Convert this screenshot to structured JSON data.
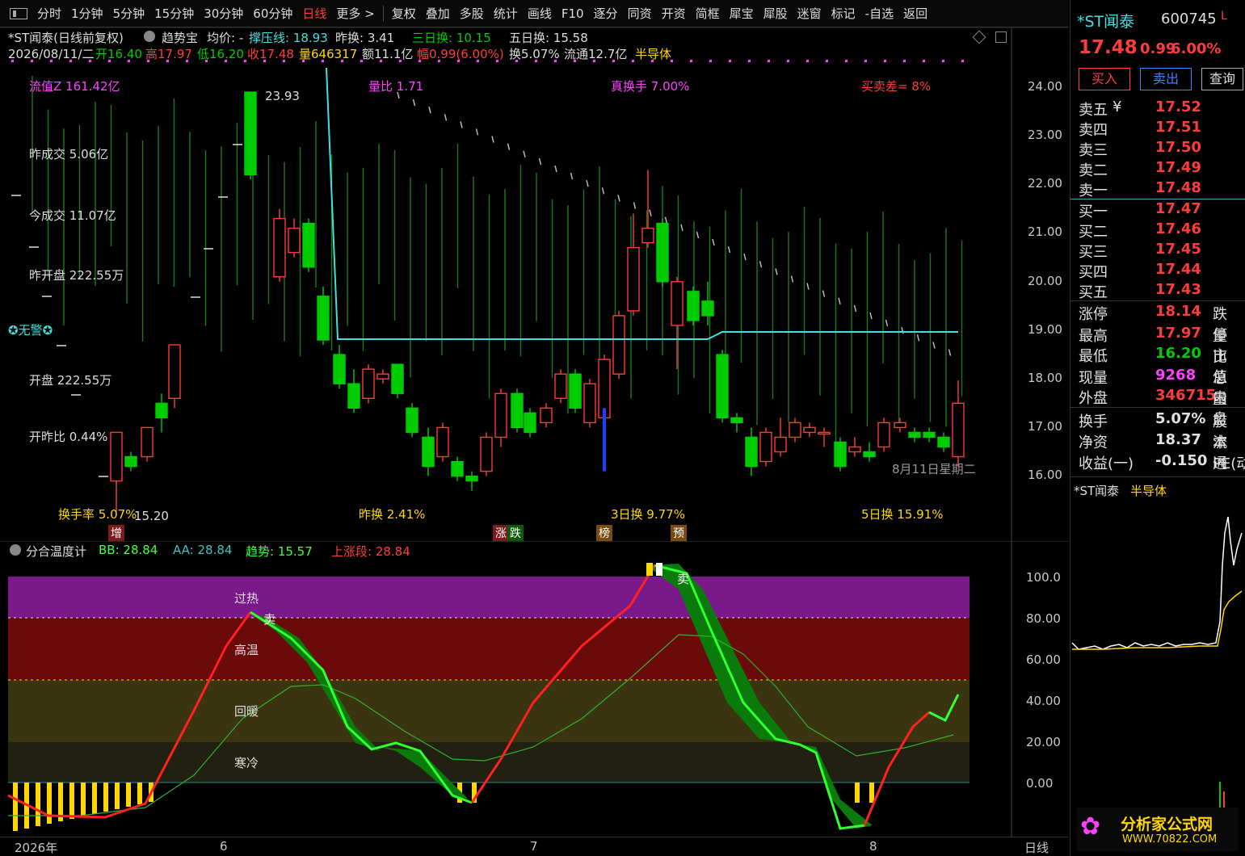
{
  "toolbar": {
    "items": [
      "分时",
      "1分钟",
      "5分钟",
      "15分钟",
      "30分钟",
      "60分钟",
      "日线",
      "更多 >",
      "复权",
      "叠加",
      "多股",
      "统计",
      "画线",
      "F10",
      "逐分",
      "同资",
      "开资",
      "简框",
      "犀宝",
      "犀股",
      "迷窗",
      "标记",
      "-自选",
      "返回"
    ],
    "active": "日线"
  },
  "header": {
    "stock": "*ST闻泰(日线前复权)",
    "formula": "趋势宝",
    "avg": "均价: -",
    "pressure": "撑压线: 18.93",
    "prev_turn": "昨换: 3.41",
    "three_turn": "三日换: 10.15",
    "five_turn": "五日换: 15.58",
    "date": "2026/08/11/二",
    "open": "开16.40",
    "high": "高17.97",
    "low": "低16.20",
    "close": "收17.48",
    "volume": "量646317",
    "amount": "额11.1亿",
    "amp": "幅0.99(6.00%)",
    "turnover": "换5.07%",
    "float": "流通12.7亿",
    "sector": "半导体"
  },
  "overlay": {
    "float_cap": "流值Z 161.42亿",
    "vol_ratio": "量比 1.71",
    "true_turn": "真换手 7.00%",
    "bid_ask": "买卖差= 8%",
    "prev_deal": "昨成交 5.06亿",
    "today_deal": "今成交 11.07亿",
    "prev_open_amt": "昨开盘 222.55万",
    "alarm": "无警",
    "open_amt": "开盘 222.55万",
    "open_ratio": "开昨比 0.44%",
    "turn_rate": "换手率 5.07%",
    "prev_turn2": "昨换 2.41%",
    "turn3": "3日换 9.77%",
    "turn5": "5日换 15.91%",
    "high_mark": "23.93",
    "low_mark": "15.20",
    "date_mark": "8月11日星期二",
    "badges": [
      "增",
      "涨",
      "跌",
      "榜",
      "预"
    ]
  },
  "indicator": {
    "name": "分合温度计",
    "bb": "BB: 28.84",
    "aa": "AA: 28.84",
    "trend": "趋势: 15.57",
    "up": "上涨段: 28.84",
    "zones": [
      "过热",
      "高温",
      "回暖",
      "寒冷"
    ],
    "sell": "卖"
  },
  "price_axis": [
    "24.00",
    "23.00",
    "22.00",
    "21.00",
    "20.00",
    "19.00",
    "18.00",
    "17.00",
    "16.00"
  ],
  "ind_axis": [
    "100.0",
    "80.00",
    "60.00",
    "40.00",
    "20.00",
    "0.00"
  ],
  "xaxis": {
    "labels": [
      "2026年",
      "6",
      "7",
      "8"
    ],
    "period": "日线"
  },
  "quote": {
    "name": "*ST闻泰",
    "code": "600745",
    "flag": "L",
    "price": "17.48",
    "change": "0.99",
    "pct": "6.00%",
    "buy": "买入",
    "sell": "卖出",
    "query": "查询",
    "asks": [
      {
        "l": "卖五",
        "v": "17.52"
      },
      {
        "l": "卖四",
        "v": "17.51"
      },
      {
        "l": "卖三",
        "v": "17.50"
      },
      {
        "l": "卖二",
        "v": "17.49"
      },
      {
        "l": "卖一",
        "v": "17.48"
      }
    ],
    "bids": [
      {
        "l": "买一",
        "v": "17.47"
      },
      {
        "l": "买二",
        "v": "17.46"
      },
      {
        "l": "买三",
        "v": "17.45"
      },
      {
        "l": "买四",
        "v": "17.44"
      },
      {
        "l": "买五",
        "v": "17.43"
      }
    ],
    "stats": [
      {
        "l": "涨停",
        "v": "18.14",
        "t": "跌停"
      },
      {
        "l": "最高",
        "v": "17.97",
        "t": "量比"
      },
      {
        "l": "最低",
        "v": "16.20",
        "t": "市值"
      },
      {
        "l": "现量",
        "v": "9268",
        "t": "总量"
      },
      {
        "l": "外盘",
        "v": "346715",
        "t": "内盘"
      }
    ],
    "extra": [
      {
        "l": "换手",
        "v": "5.07%",
        "t": "股本"
      },
      {
        "l": "净资",
        "v": "18.37",
        "t": "流通"
      },
      {
        "l": "收益(一)",
        "v": "-0.150",
        "t": "PE(动"
      }
    ],
    "mini_title": "*ST闻泰",
    "mini_sector": "半导体"
  },
  "colors": {
    "up": "#ff3b3b",
    "down": "#00cc00",
    "cyan": "#40e0e0",
    "magenta": "#ff40ff",
    "yellow": "#ffd700"
  },
  "logo": {
    "text": "分析家公式网",
    "url": "WWW.70822.COM"
  }
}
